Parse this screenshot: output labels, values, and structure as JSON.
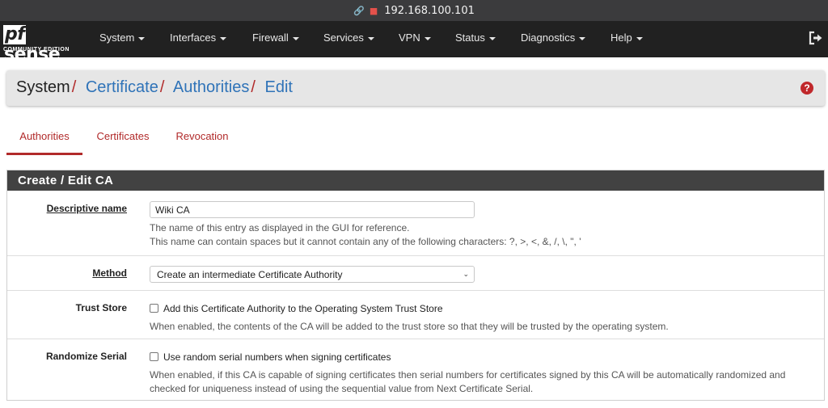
{
  "url": "192.168.100.101",
  "logo": {
    "pf": "pf",
    "sense": "sense",
    "edition": "COMMUNITY EDITION"
  },
  "menu": [
    "System",
    "Interfaces",
    "Firewall",
    "Services",
    "VPN",
    "Status",
    "Diagnostics",
    "Help"
  ],
  "breadcrumb": [
    "System",
    "Certificate",
    "Authorities",
    "Edit"
  ],
  "tabs": [
    "Authorities",
    "Certificates",
    "Revocation"
  ],
  "panel": {
    "title": "Create / Edit CA",
    "descriptive_name": {
      "label": "Descriptive name",
      "value": "Wiki CA",
      "help1": "The name of this entry as displayed in the GUI for reference.",
      "help2": "This name can contain spaces but it cannot contain any of the following characters: ?, >, <, &, /, \\, \", '"
    },
    "method": {
      "label": "Method",
      "value": "Create an intermediate Certificate Authority"
    },
    "trust_store": {
      "label": "Trust Store",
      "checkbox": "Add this Certificate Authority to the Operating System Trust Store",
      "help": "When enabled, the contents of the CA will be added to the trust store so that they will be trusted by the operating system."
    },
    "randomize_serial": {
      "label": "Randomize Serial",
      "checkbox": "Use random serial numbers when signing certificates",
      "help1": "When enabled, if this CA is capable of signing certificates then serial numbers for certificates signed by this CA will be automatically randomized and",
      "help2": "checked for uniqueness instead of using the sequential value from Next Certificate Serial."
    }
  },
  "colors": {
    "brand_red": "#b12a2a",
    "link_blue": "#2f73b8",
    "navbar": "#212121"
  },
  "icons": {
    "link": "link-icon",
    "lock": "lock-icon",
    "caret": "caret-down-icon",
    "logout": "logout-icon",
    "help": "question-circle-icon",
    "select": "chevron-down-icon"
  }
}
